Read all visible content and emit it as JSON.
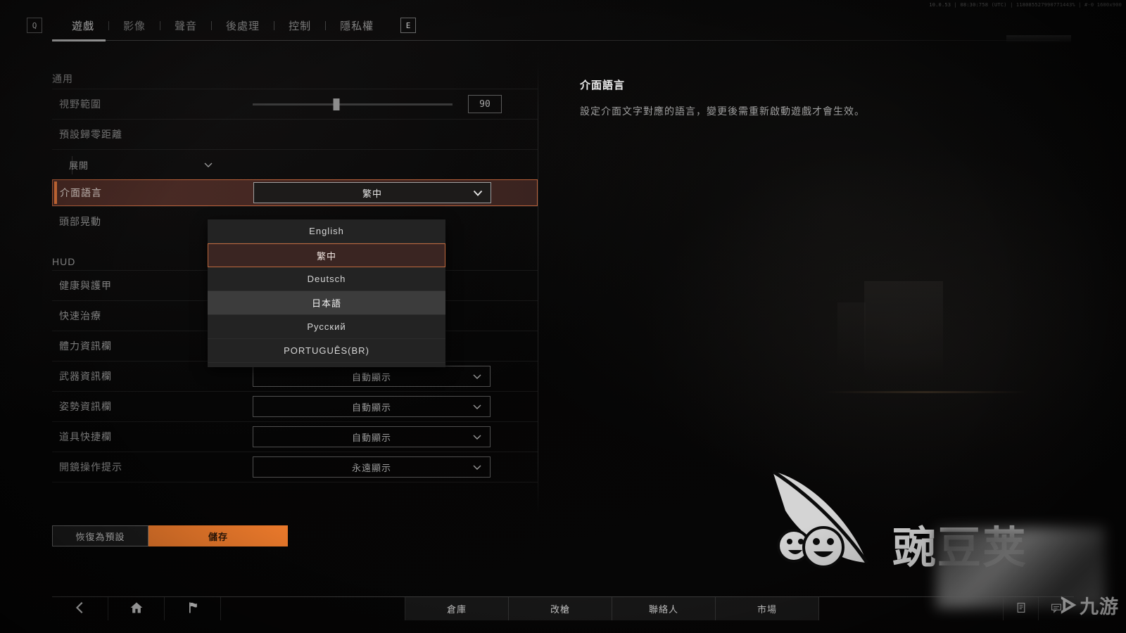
{
  "debug": {
    "text": "10.0.53 | 08:30:758 (UTC) | 118085527990771443% | #-0 1600x900"
  },
  "tabbar": {
    "left_key": "Q",
    "right_key": "E",
    "tabs": [
      {
        "label": "遊戲",
        "active": true
      },
      {
        "label": "影像",
        "active": false
      },
      {
        "label": "聲音",
        "active": false
      },
      {
        "label": "後處理",
        "active": false
      },
      {
        "label": "控制",
        "active": false
      },
      {
        "label": "隱私權",
        "active": false
      }
    ]
  },
  "settings": {
    "sections": [
      {
        "title": "通用",
        "rows": [
          {
            "label": "視野範圍",
            "type": "slider",
            "value": "90",
            "percent": 42
          },
          {
            "label": "預設歸零距離",
            "type": "header"
          },
          {
            "label": "展開",
            "type": "dropdown-bare",
            "value": "展開"
          },
          {
            "label": "介面語言",
            "type": "dropdown",
            "value": "繁中",
            "focused": true
          },
          {
            "label": "頭部晃動",
            "type": "plain"
          }
        ]
      },
      {
        "title": "HUD",
        "rows": [
          {
            "label": "健康與護甲",
            "type": "plain"
          },
          {
            "label": "快速治療",
            "type": "plain"
          },
          {
            "label": "體力資訊欄",
            "type": "plain"
          },
          {
            "label": "武器資訊欄",
            "type": "dropdown",
            "value": "自動顯示"
          },
          {
            "label": "姿勢資訊欄",
            "type": "dropdown",
            "value": "自動顯示"
          },
          {
            "label": "道具快捷欄",
            "type": "dropdown",
            "value": "自動顯示"
          },
          {
            "label": "開鏡操作提示",
            "type": "dropdown",
            "value": "永遠顯示"
          }
        ]
      }
    ],
    "language_dropdown": {
      "open": true,
      "options": [
        {
          "label": "English",
          "state": "normal"
        },
        {
          "label": "繁中",
          "state": "selected"
        },
        {
          "label": "Deutsch",
          "state": "normal"
        },
        {
          "label": "日本語",
          "state": "hover"
        },
        {
          "label": "Русский",
          "state": "normal"
        },
        {
          "label": "PORTUGUÊS(BR)",
          "state": "normal"
        }
      ]
    }
  },
  "actions": {
    "restore_default": "恢復為預設",
    "save": "儲存"
  },
  "description": {
    "title": "介面語言",
    "body": "設定介面文字對應的語言，變更後需重新啟動遊戲才會生效。"
  },
  "bottomnav": {
    "items": [
      {
        "name": "back",
        "label": "",
        "icon": "chevron-left-icon"
      },
      {
        "name": "home",
        "label": "",
        "icon": "home-icon"
      },
      {
        "name": "flag",
        "label": "",
        "icon": "flag-icon"
      },
      {
        "name": "warehouse",
        "label": "倉庫",
        "icon": ""
      },
      {
        "name": "gunsmith",
        "label": "改槍",
        "icon": ""
      },
      {
        "name": "contacts",
        "label": "聯絡人",
        "icon": ""
      },
      {
        "name": "market",
        "label": "市場",
        "icon": ""
      },
      {
        "name": "notes",
        "label": "",
        "icon": "note-icon"
      },
      {
        "name": "chat",
        "label": "",
        "icon": "chat-icon"
      }
    ]
  },
  "watermark": {
    "text": "豌豆荚",
    "logo_mark": "ᗌ",
    "logo_text": "九游"
  },
  "colors": {
    "accent_orange": "#f07c2c",
    "focus_border": "#b8603a",
    "focus_fill": "#4b2b25",
    "text_primary": "#f0f0f0",
    "text_dim": "#8a8a8a"
  }
}
